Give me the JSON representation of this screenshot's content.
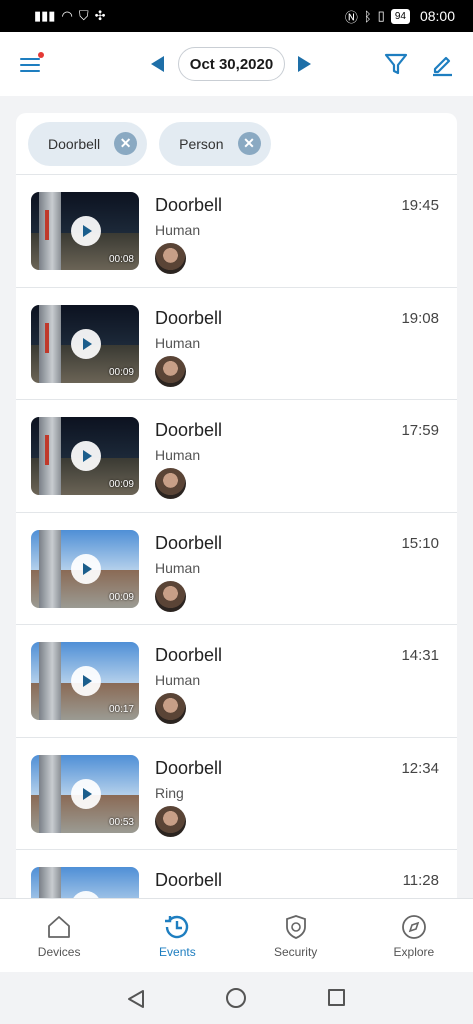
{
  "status_bar": {
    "time": "08:00",
    "battery": "94"
  },
  "header": {
    "date": "Oct 30,2020"
  },
  "filters": [
    {
      "label": "Doorbell"
    },
    {
      "label": "Person"
    }
  ],
  "events": [
    {
      "title": "Doorbell",
      "subtitle": "Human",
      "time": "19:45",
      "duration": "00:08",
      "scene": "night"
    },
    {
      "title": "Doorbell",
      "subtitle": "Human",
      "time": "19:08",
      "duration": "00:09",
      "scene": "night"
    },
    {
      "title": "Doorbell",
      "subtitle": "Human",
      "time": "17:59",
      "duration": "00:09",
      "scene": "night"
    },
    {
      "title": "Doorbell",
      "subtitle": "Human",
      "time": "15:10",
      "duration": "00:09",
      "scene": "day"
    },
    {
      "title": "Doorbell",
      "subtitle": "Human",
      "time": "14:31",
      "duration": "00:17",
      "scene": "day"
    },
    {
      "title": "Doorbell",
      "subtitle": "Ring",
      "time": "12:34",
      "duration": "00:53",
      "scene": "day"
    },
    {
      "title": "Doorbell",
      "subtitle": "",
      "time": "11:28",
      "duration": "",
      "scene": "day"
    }
  ],
  "tabs": [
    {
      "label": "Devices",
      "icon": "home-icon",
      "active": false
    },
    {
      "label": "Events",
      "icon": "clock-history-icon",
      "active": true
    },
    {
      "label": "Security",
      "icon": "shield-icon",
      "active": false
    },
    {
      "label": "Explore",
      "icon": "compass-icon",
      "active": false
    }
  ],
  "colors": {
    "accent": "#1e7ec0",
    "chip_bg": "#e3ebf2",
    "alert_dot": "#e53935"
  }
}
